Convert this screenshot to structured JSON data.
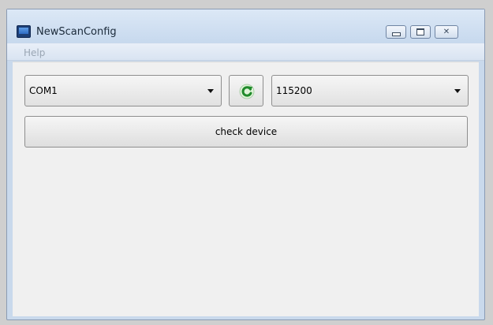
{
  "window": {
    "title": "NewScanConfig",
    "icon": "app-window-icon"
  },
  "controls": {
    "minimize_icon": "minimize-icon",
    "maximize_icon": "maximize-icon",
    "close_glyph": "✕"
  },
  "menu": {
    "items": [
      {
        "label": "Help",
        "enabled": false
      }
    ]
  },
  "form": {
    "port": {
      "selected": "COM1"
    },
    "refresh": {
      "icon": "refresh-icon",
      "color": "#2e9e2e"
    },
    "baud": {
      "selected": "115200"
    },
    "check_button_label": "check device"
  }
}
